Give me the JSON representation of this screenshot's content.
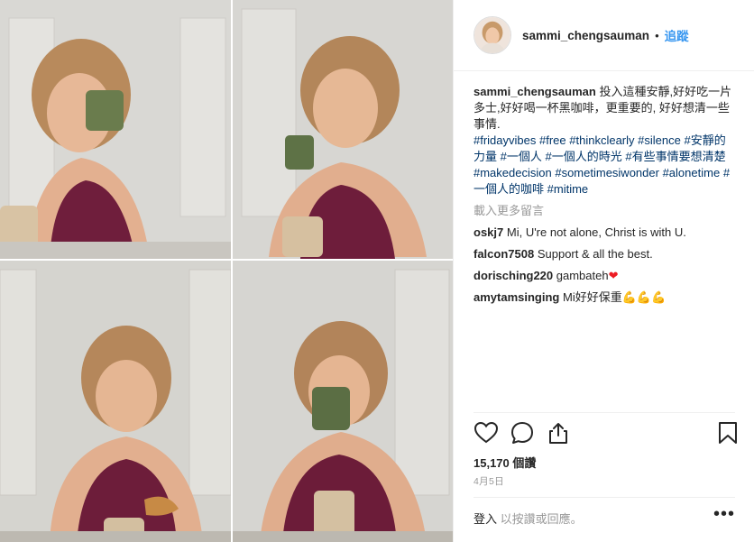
{
  "header": {
    "username": "sammi_chengsauman",
    "separator": "•",
    "follow_label": "追蹤"
  },
  "caption": {
    "username": "sammi_chengsauman",
    "text": "投入這種安靜,好好吃一片多士,好好喝一杯黑咖啡，更重要的, 好好想清一些事情.",
    "hashtags": [
      "#fridayvibes",
      "#free",
      "#thinkclearly",
      "#silence",
      "#安靜的力量",
      "#一個人",
      "#一個人的時光",
      "#有些事情要想清楚",
      "#makedecision",
      "#sometimesiwonder",
      "#alonetime",
      "#一個人的咖啡",
      "#mitime"
    ]
  },
  "load_more_label": "載入更多留言",
  "comments": [
    {
      "username": "oskj7",
      "text": "Mi, U're not alone, Christ is with U."
    },
    {
      "username": "falcon7508",
      "text": "Support & all the best."
    },
    {
      "username": "dorisching220",
      "text": "gambateh",
      "emoji": "❤"
    },
    {
      "username": "amytamsinging",
      "text": "Mi好好保重",
      "emoji": "💪💪💪"
    }
  ],
  "likes_label": "15,170 個讚",
  "date_label": "4月5日",
  "footer": {
    "login_label": "登入",
    "suffix": " 以按讚或回應。",
    "more_label": "•••"
  },
  "colors": {
    "accent": "#3897f0",
    "hashtag": "#003569",
    "muted": "#999999",
    "heart": "#ed1c24"
  },
  "icons": [
    "heart-icon",
    "comment-icon",
    "share-icon",
    "bookmark-icon",
    "more-options-icon"
  ]
}
